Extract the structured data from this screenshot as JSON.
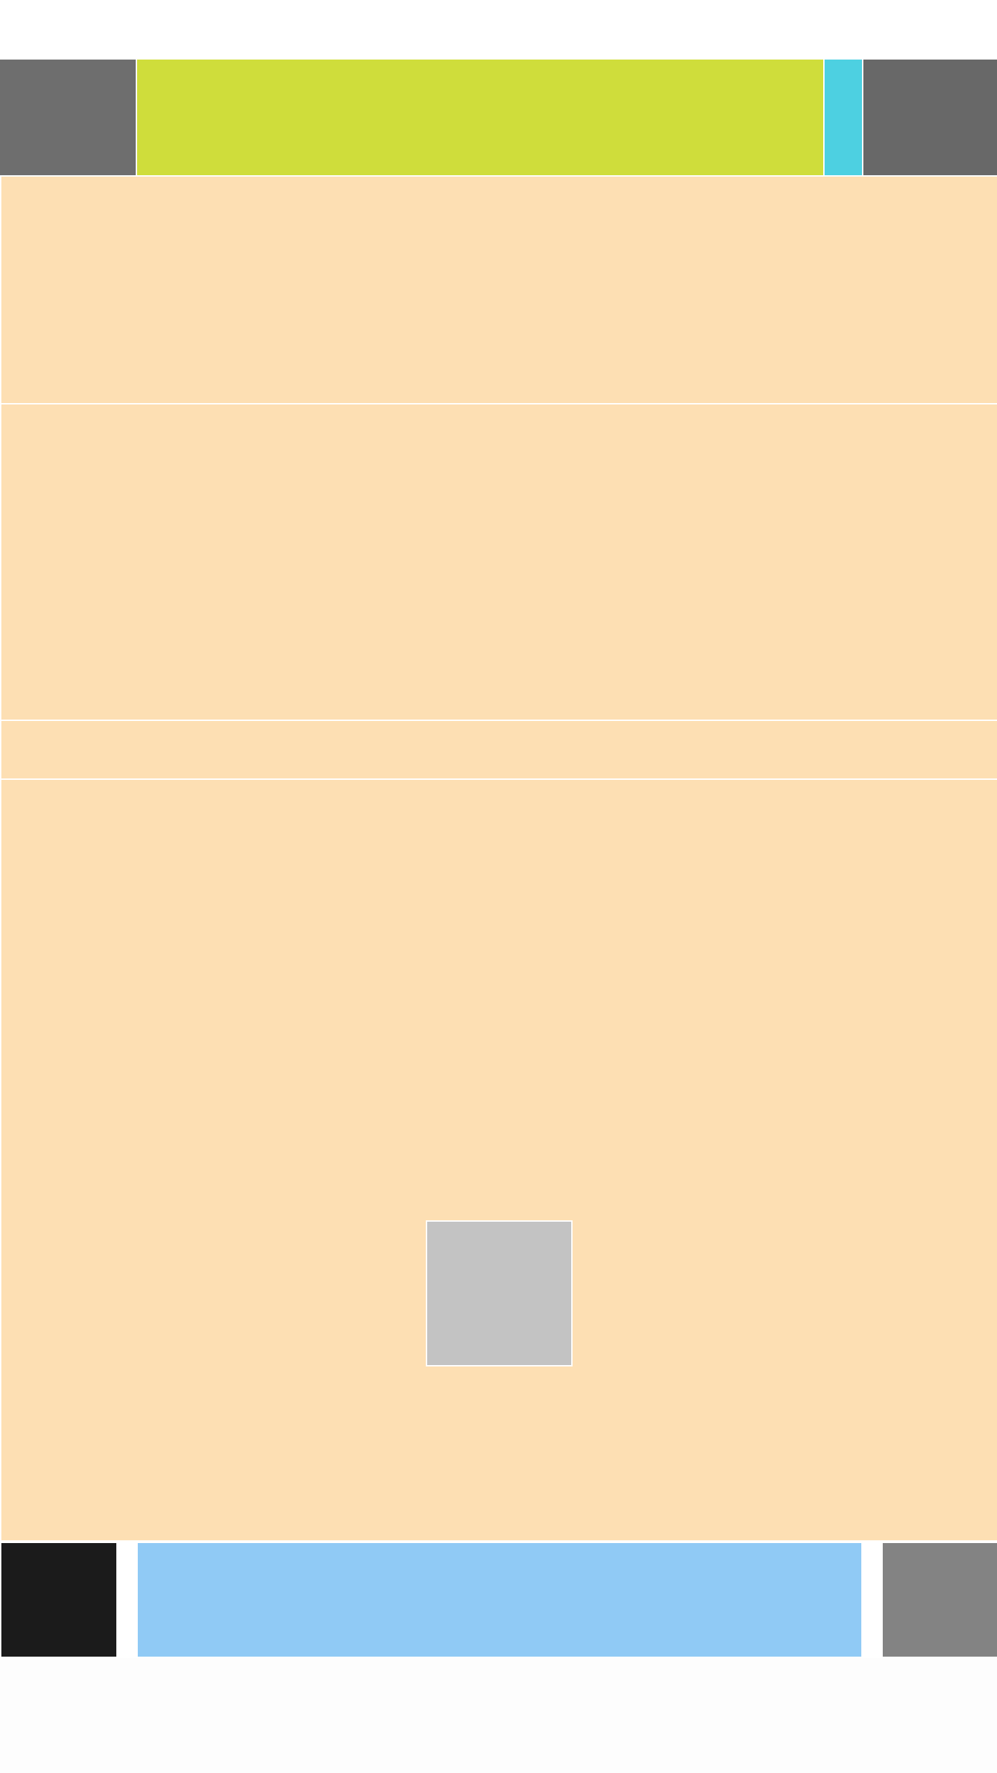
{
  "colors": {
    "page_background": "#ffffff",
    "page_bottom_background": "#fdfdfd",
    "divider": "#ffffff",
    "header_left": "#6e6e6e",
    "header_center": "#cfdd3b",
    "header_accent": "#4dd0e1",
    "header_right": "#686868",
    "content_panel": "#fddfb3",
    "placeholder": "#c3c3c3",
    "footer_left": "#1b1b1b",
    "footer_center": "#90caf5",
    "footer_right": "#838383"
  },
  "header": {
    "left_block": "",
    "center_block": "",
    "accent_block": "",
    "right_block": ""
  },
  "content": {
    "section_1": "",
    "section_2": "",
    "section_3": "",
    "section_4": "",
    "image_placeholder": ""
  },
  "footer": {
    "left_block": "",
    "center_block": "",
    "right_block": ""
  }
}
